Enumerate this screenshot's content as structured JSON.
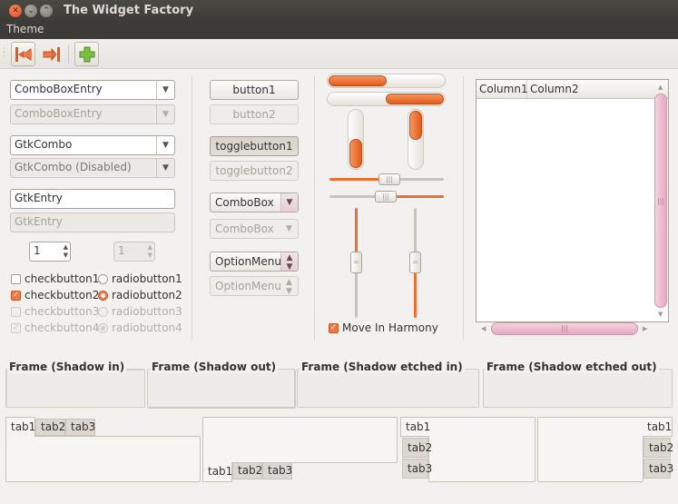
{
  "window": {
    "title": "The Widget Factory"
  },
  "menubar": {
    "items": [
      "Theme"
    ]
  },
  "toolbar": {
    "icons": [
      "go-first-icon",
      "go-last-icon",
      "add-icon"
    ],
    "accent": "#f07746",
    "add_color": "#6fb43a"
  },
  "col1": {
    "combo_entry": "ComboBoxEntry",
    "combo_entry_disabled": "ComboBoxEntry",
    "gtk_combo": "GtkCombo",
    "gtk_combo_disabled": "GtkCombo (Disabled)",
    "entry": "GtkEntry",
    "entry_disabled": "GtkEntry",
    "spin": "1",
    "spin_disabled": "1",
    "checks": [
      {
        "label": "checkbutton1",
        "checked": false,
        "disabled": false
      },
      {
        "label": "checkbutton2",
        "checked": true,
        "disabled": false
      },
      {
        "label": "checkbutton3",
        "checked": false,
        "disabled": true
      },
      {
        "label": "checkbutton4",
        "checked": true,
        "disabled": true
      }
    ],
    "radios": [
      {
        "label": "radiobutton1",
        "checked": false,
        "disabled": false
      },
      {
        "label": "radiobutton2",
        "checked": true,
        "disabled": false
      },
      {
        "label": "radiobutton3",
        "checked": false,
        "disabled": true
      },
      {
        "label": "radiobutton4",
        "checked": true,
        "disabled": true
      }
    ]
  },
  "col2": {
    "button1": "button1",
    "button2": "button2",
    "toggle1": "togglebutton1",
    "toggle2": "togglebutton2",
    "combobox": "ComboBox",
    "combobox_disabled": "ComboBox",
    "optionmenu": "OptionMenu",
    "optionmenu_disabled": "OptionMenu"
  },
  "col3": {
    "progress_h1": 0.5,
    "progress_h2": 0.5,
    "progress_v1": 0.5,
    "progress_v2": 0.5,
    "scale_h1": 0.53,
    "scale_h2": 0.5,
    "scale_v1": 0.5,
    "scale_v2": 0.5,
    "harmony_label": "Move In Harmony",
    "harmony_checked": true
  },
  "tree": {
    "columns": [
      "Column1",
      "Column2"
    ]
  },
  "frames": [
    {
      "label": "Frame (Shadow in)"
    },
    {
      "label": "Frame (Shadow out)"
    },
    {
      "label": "Frame (Shadow etched in)"
    },
    {
      "label": "Frame (Shadow etched out)"
    }
  ],
  "notebooks": {
    "tabs": [
      "tab1",
      "tab2",
      "tab3"
    ]
  }
}
